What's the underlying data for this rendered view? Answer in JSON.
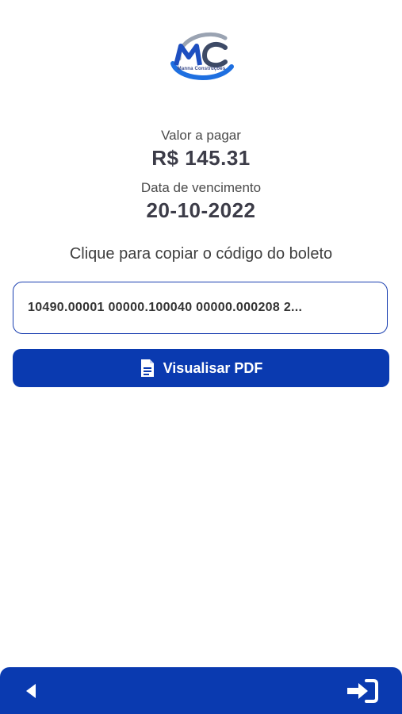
{
  "logo": {
    "caption": "Manna Construções",
    "brand_color": "#1e4fc0"
  },
  "payment": {
    "amount_label": "Valor a pagar",
    "amount_value": "R$ 145.31",
    "due_label": "Data de vencimento",
    "due_value": "20-10-2022"
  },
  "boleto": {
    "instruction": "Clique para copiar o código do boleto",
    "code": "10490.00001 00000.100040 00000.000208 2..."
  },
  "actions": {
    "view_pdf_label": "Visualisar PDF",
    "view_pdf_icon": "document-icon"
  },
  "bottom_bar": {
    "back_icon": "back-triangle-icon",
    "login_icon": "sign-in-icon",
    "color": "#0a3ab0"
  }
}
